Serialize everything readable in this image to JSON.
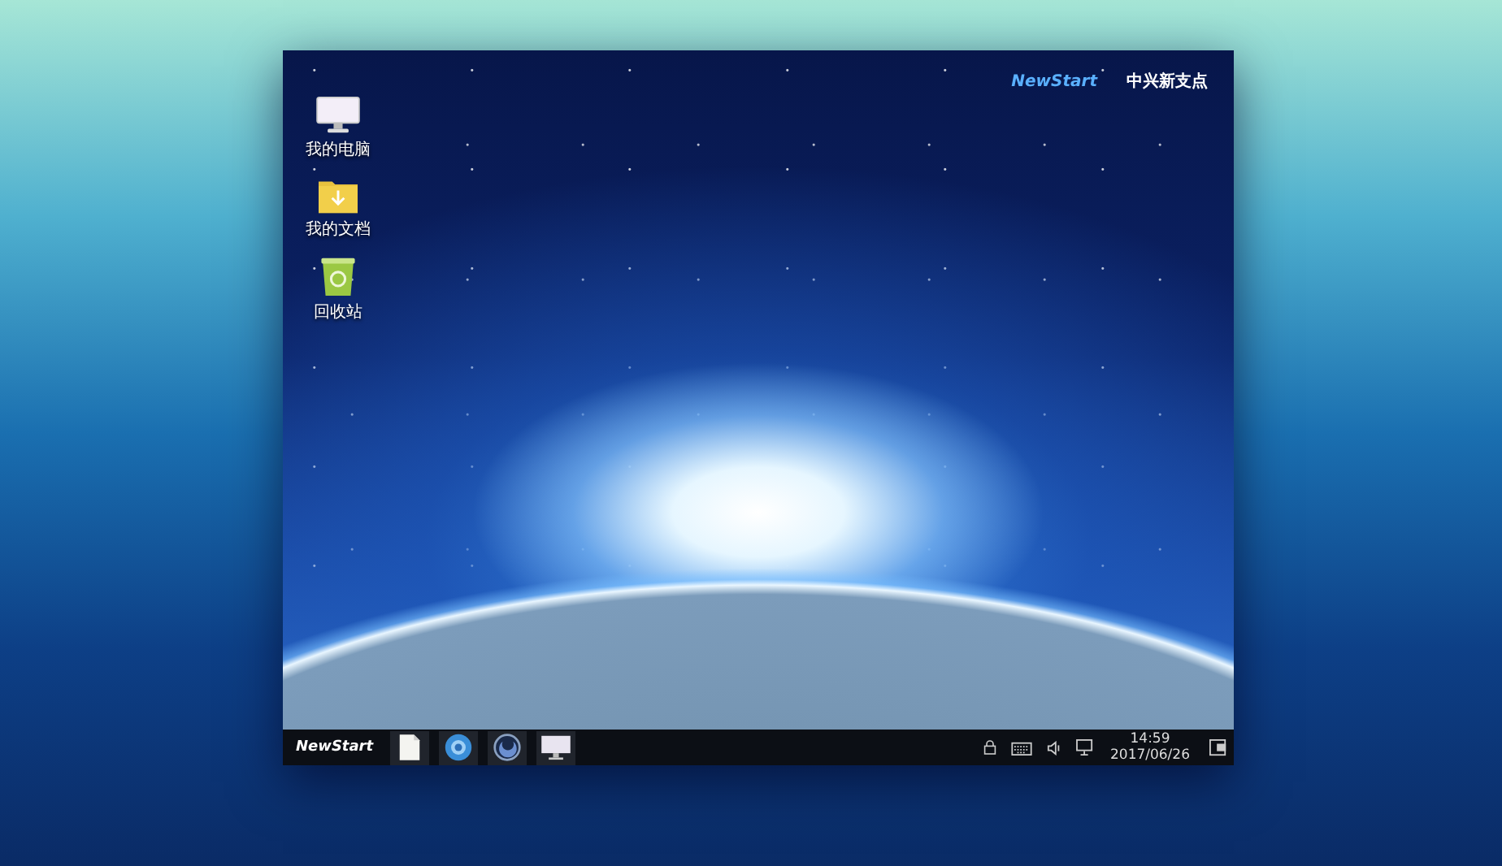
{
  "desktop": {
    "icons": [
      {
        "kind": "computer",
        "label": "我的电脑"
      },
      {
        "kind": "documents",
        "label": "我的文档"
      },
      {
        "kind": "trash",
        "label": "回收站"
      }
    ],
    "logo": {
      "brand": "NewStart",
      "title": "中兴新支点"
    }
  },
  "taskbar": {
    "start_label": "NewStart",
    "apps": [
      {
        "kind": "document"
      },
      {
        "kind": "browser"
      },
      {
        "kind": "player"
      },
      {
        "kind": "monitor"
      }
    ],
    "tray": [
      {
        "kind": "lock"
      },
      {
        "kind": "keyboard"
      },
      {
        "kind": "volume"
      },
      {
        "kind": "network"
      }
    ],
    "clock": {
      "time": "14:59",
      "date": "2017/06/26"
    },
    "end_icon": {
      "kind": "logout"
    }
  }
}
